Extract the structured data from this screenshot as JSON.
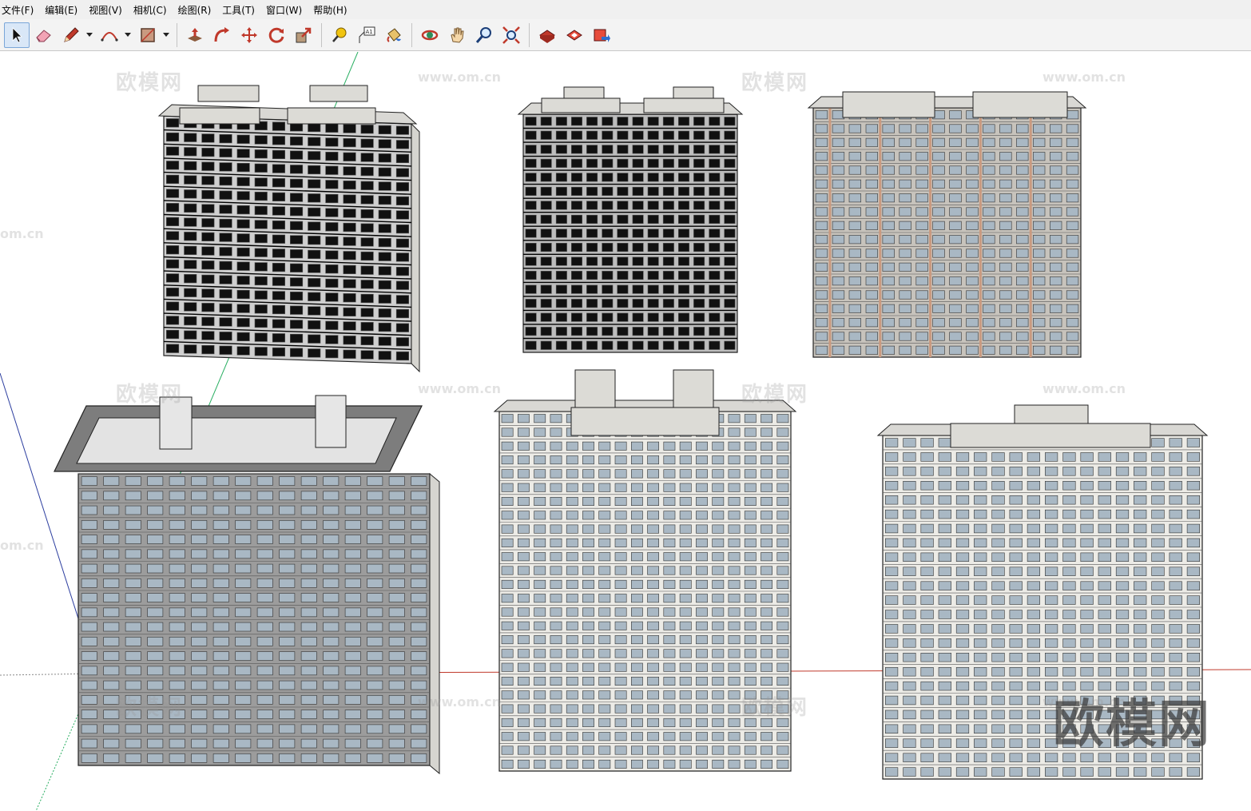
{
  "menu": [
    {
      "label": "文件(F)"
    },
    {
      "label": "编辑(E)"
    },
    {
      "label": "视图(V)"
    },
    {
      "label": "相机(C)"
    },
    {
      "label": "绘图(R)"
    },
    {
      "label": "工具(T)"
    },
    {
      "label": "窗口(W)"
    },
    {
      "label": "帮助(H)"
    }
  ],
  "toolbar": {
    "tools": [
      {
        "icon": "select-arrow-icon",
        "active": true
      },
      {
        "icon": "eraser-icon"
      },
      {
        "icon": "pencil-icon"
      },
      {
        "icon": "arc-icon"
      },
      {
        "icon": "rectangle-icon"
      },
      {
        "icon": "push-pull-icon"
      },
      {
        "icon": "follow-me-icon"
      },
      {
        "icon": "move-icon"
      },
      {
        "icon": "rotate-icon"
      },
      {
        "icon": "scale-icon"
      },
      {
        "icon": "tape-measure-icon"
      },
      {
        "icon": "text-label-icon",
        "text": "A1"
      },
      {
        "icon": "paint-bucket-icon"
      },
      {
        "icon": "orbit-icon"
      },
      {
        "icon": "pan-hand-icon"
      },
      {
        "icon": "zoom-icon"
      },
      {
        "icon": "zoom-extents-icon"
      },
      {
        "icon": "warehouse-icon"
      },
      {
        "icon": "share-model-icon"
      },
      {
        "icon": "extension-warehouse-icon"
      }
    ]
  },
  "watermarks": {
    "cn": "欧模网",
    "url": "www.om.cn",
    "url_partial": "om.cn"
  },
  "brand_logo": "欧模网",
  "colors": {
    "axis_red": "#c0392b",
    "axis_green": "#27ae60",
    "axis_blue": "#2c3e9f",
    "facade_light": "#ecebe6",
    "facade_dark": "#1a1a1a",
    "accent_brick": "#c99a80",
    "glass": "#a9b8c4"
  }
}
